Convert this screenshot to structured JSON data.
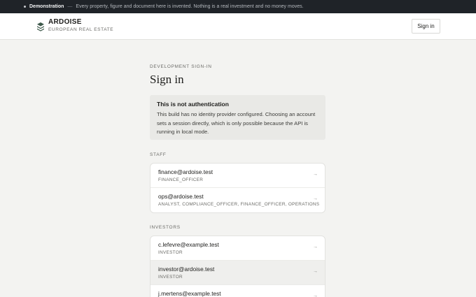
{
  "banner": {
    "label": "Demonstration",
    "separator": "—",
    "text": "Every property, figure and document here is invented. Nothing is a real investment and no money moves."
  },
  "header": {
    "brand_name": "ARDOISE",
    "brand_sub": "EUROPEAN REAL ESTATE",
    "signin_label": "Sign in"
  },
  "main": {
    "eyebrow": "DEVELOPMENT SIGN-IN",
    "title": "Sign in",
    "notice": {
      "title": "This is not authentication",
      "body": "This build has no identity provider configured. Choosing an account sets a session directly, which is only possible because the API is running in local mode."
    },
    "staff_label": "STAFF",
    "staff": [
      {
        "email": "finance@ardoise.test",
        "roles": "FINANCE_OFFICER"
      },
      {
        "email": "ops@ardoise.test",
        "roles": "ANALYST, COMPLIANCE_OFFICER, FINANCE_OFFICER, OPERATIONS"
      }
    ],
    "investors_label": "INVESTORS",
    "investors": [
      {
        "email": "c.lefevre@example.test",
        "roles": "INVESTOR"
      },
      {
        "email": "investor@ardoise.test",
        "roles": "INVESTOR"
      },
      {
        "email": "j.mertens@example.test",
        "roles": ""
      }
    ],
    "arrow": "→"
  },
  "colors": {
    "banner_bg": "#1f2328",
    "page_bg": "#f3f3f1",
    "notice_bg": "#e9e9e6",
    "brand_logo": "#3f5a4c"
  },
  "icons": {
    "logo": "stacked-layers-icon",
    "row_arrow": "arrow-right-icon"
  }
}
